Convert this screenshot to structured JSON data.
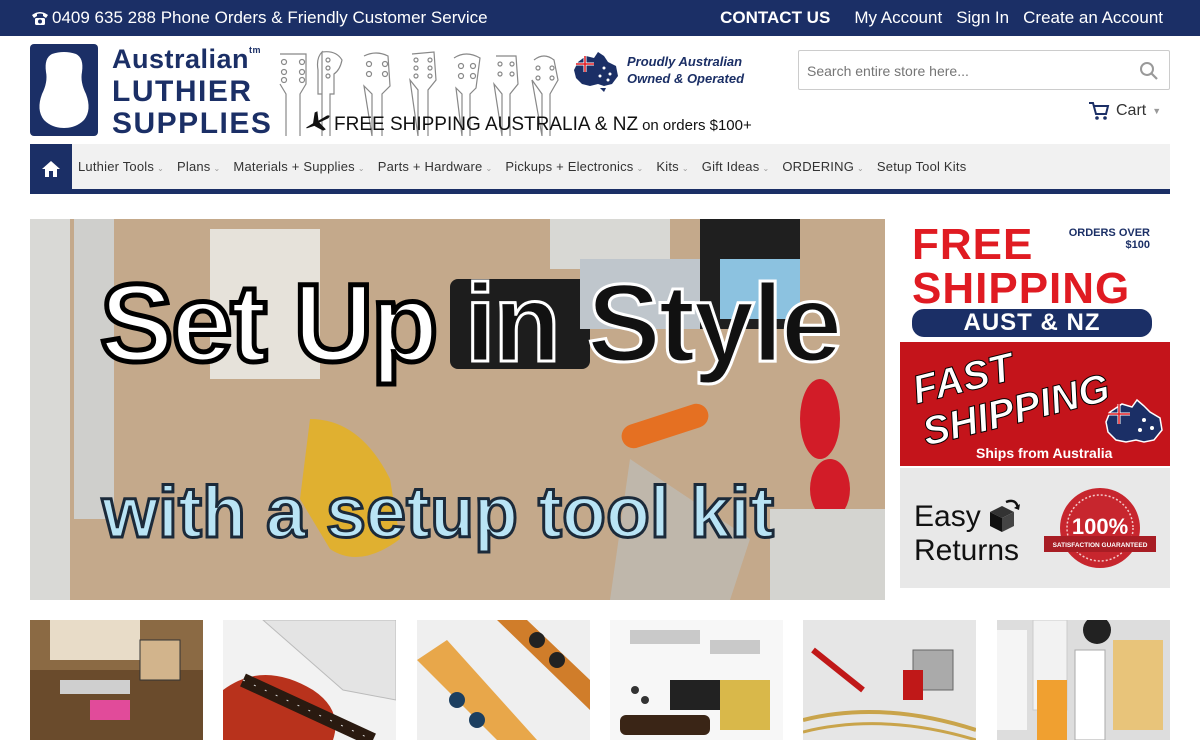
{
  "topbar": {
    "phone": "0409 635 288 Phone Orders & Friendly Customer Service",
    "contact": "CONTACT US",
    "my_account": "My Account",
    "sign_in": "Sign In",
    "create_account": "Create an Account"
  },
  "logo": {
    "line1": "Australian",
    "tm": "tm",
    "line2": "LUTHIER",
    "line3": "SUPPLIES"
  },
  "header": {
    "proudly_line1": "Proudly Australian",
    "proudly_line2": "Owned & Operated",
    "free_shipping": "FREE SHIPPING AUSTRALIA & NZ",
    "free_shipping_small": "on orders $100+"
  },
  "search": {
    "placeholder": "Search entire store here..."
  },
  "cart": {
    "label": "Cart"
  },
  "nav": {
    "items": [
      {
        "label": "Luthier Tools",
        "has_menu": true
      },
      {
        "label": "Plans",
        "has_menu": true
      },
      {
        "label": "Materials + Supplies",
        "has_menu": true
      },
      {
        "label": "Parts + Hardware",
        "has_menu": true
      },
      {
        "label": "Pickups + Electronics",
        "has_menu": true
      },
      {
        "label": "Kits",
        "has_menu": true
      },
      {
        "label": "Gift Ideas",
        "has_menu": true
      },
      {
        "label": "ORDERING",
        "has_menu": true
      },
      {
        "label": "Setup Tool Kits",
        "has_menu": false
      }
    ]
  },
  "hero": {
    "line1a": "Set Up",
    "line1b": "in Style",
    "line2": "with a setup tool kit"
  },
  "promos": {
    "free_shipping": {
      "orders_line1": "ORDERS OVER",
      "orders_line2": "$100",
      "free": "FREE",
      "shipping": "SHIPPING",
      "aust": "AUST & NZ"
    },
    "fast_shipping": {
      "fast": "FAST",
      "shipping": "SHIPPING",
      "from": "Ships from Australia"
    },
    "easy_returns": {
      "easy": "Easy",
      "returns": "Returns",
      "seal_pct": "100%",
      "seal_text": "SATISFACTION GUARANTEED"
    }
  },
  "colors": {
    "navy": "#1b2f66",
    "red": "#e01b22",
    "nav_bg": "#f1f1f1"
  },
  "icons": {
    "phone": "phone-icon",
    "search": "search-icon",
    "cart": "cart-icon",
    "home": "home-icon",
    "plane": "plane-icon"
  }
}
